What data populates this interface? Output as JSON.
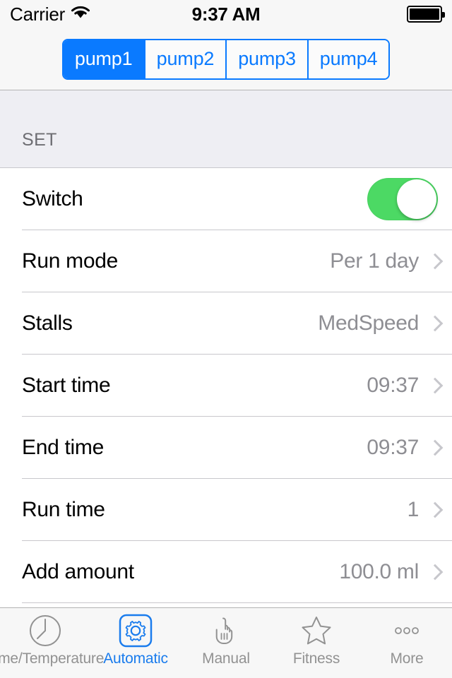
{
  "status_bar": {
    "carrier": "Carrier",
    "wifi_icon": "wifi-icon",
    "time": "9:37 AM",
    "battery_icon": "battery-full-icon"
  },
  "segmented_control": {
    "selected_index": 0,
    "accent_color": "#0a7aff",
    "segments": [
      {
        "label": "pump1"
      },
      {
        "label": "pump2"
      },
      {
        "label": "pump3"
      },
      {
        "label": "pump4"
      }
    ]
  },
  "section": {
    "header": "SET",
    "header_bg": "#eeeef3"
  },
  "rows": [
    {
      "title": "Switch",
      "type": "toggle",
      "value": "",
      "toggle_on": true,
      "toggle_color": "#4cd964"
    },
    {
      "title": "Run mode",
      "type": "disclosure",
      "value": "Per 1 day"
    },
    {
      "title": "Stalls",
      "type": "disclosure",
      "value": "MedSpeed"
    },
    {
      "title": "Start time",
      "type": "disclosure",
      "value": "09:37"
    },
    {
      "title": "End time",
      "type": "disclosure",
      "value": "09:37"
    },
    {
      "title": "Run time",
      "type": "disclosure",
      "value": "1"
    },
    {
      "title": "Add amount",
      "type": "disclosure",
      "value": "100.0 ml"
    }
  ],
  "tab_bar": {
    "active_index": 1,
    "active_color": "#1a7ced",
    "inactive_color": "#929292",
    "tabs": [
      {
        "label": "Time/Temperature",
        "icon": "clock-icon"
      },
      {
        "label": "Automatic",
        "icon": "gear-icon"
      },
      {
        "label": "Manual",
        "icon": "pointing-hand-icon"
      },
      {
        "label": "Fitness",
        "icon": "star-icon"
      },
      {
        "label": "More",
        "icon": "ellipsis-icon"
      }
    ]
  }
}
